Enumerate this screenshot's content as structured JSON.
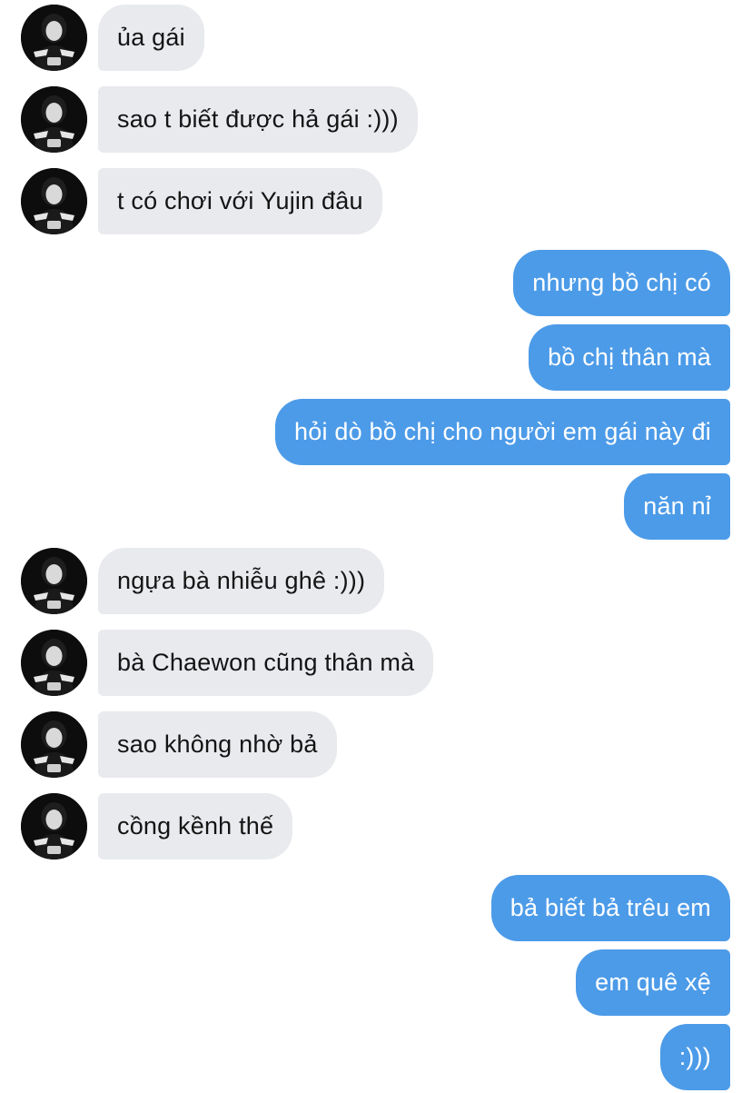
{
  "messages": [
    {
      "side": "in",
      "text": "ủa gái"
    },
    {
      "side": "in",
      "text": "sao t biết được hả gái :)))"
    },
    {
      "side": "in",
      "text": "t có chơi với Yujin đâu"
    },
    {
      "side": "out",
      "text": "nhưng bồ chị có"
    },
    {
      "side": "out",
      "text": "bồ chị thân mà"
    },
    {
      "side": "out",
      "text": "hỏi dò bồ chị cho người em gái này đi"
    },
    {
      "side": "out",
      "text": "năn nỉ"
    },
    {
      "side": "in",
      "text": "ngựa bà nhiễu ghê :)))"
    },
    {
      "side": "in",
      "text": "bà Chaewon cũng thân mà"
    },
    {
      "side": "in",
      "text": "sao không nhờ bả"
    },
    {
      "side": "in",
      "text": "cồng kềnh thế"
    },
    {
      "side": "out",
      "text": "bả biết bả trêu em"
    },
    {
      "side": "out",
      "text": "em quê xệ"
    },
    {
      "side": "out",
      "text": ":)))"
    }
  ],
  "colors": {
    "incoming_bubble": "#e9eaee",
    "outgoing_bubble": "#4c9be8",
    "incoming_text": "#141414",
    "outgoing_text": "#ffffff"
  },
  "icons": {
    "avatar": "contact-avatar-photo"
  }
}
